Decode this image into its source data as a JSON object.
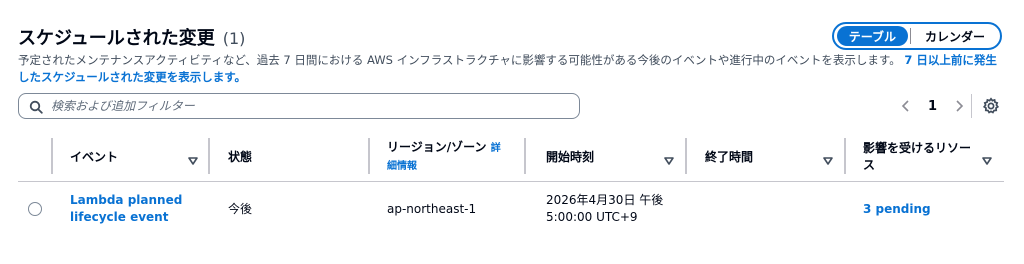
{
  "header": {
    "title": "スケジュールされた変更",
    "count": "(1)",
    "view_toggle": {
      "table_label": "テーブル",
      "calendar_label": "カレンダー",
      "selected": "テーブル"
    },
    "description": "予定されたメンテナンスアクティビティなど、過去 7 日間における AWS インフラストラクチャに影響する可能性がある今後のイベントや進行中のイベントを表示します。",
    "description_link": "7 日以上前に発生したスケジュールされた変更を表示します。"
  },
  "filter": {
    "placeholder": "検索および追加フィルター",
    "icon": "search-icon"
  },
  "pagination": {
    "current_page": "1",
    "prev_icon": "chevron-left-icon",
    "next_icon": "chevron-right-icon",
    "settings_icon": "gear-icon"
  },
  "table": {
    "columns": {
      "event": "イベント",
      "status": "状態",
      "region": "リージョン/ゾーン",
      "region_info": "詳細情報",
      "start": "開始時刻",
      "end": "終了時間",
      "resources": "影響を受けるリソース"
    },
    "rows": [
      {
        "event_line1": "Lambda planned",
        "event_line2": "lifecycle event",
        "status": "今後",
        "region": "ap-northeast-1",
        "start_line1": "2026年4月30日 午後",
        "start_line2": "5:00:00 UTC+9",
        "end": "",
        "resources": "3 pending"
      }
    ]
  },
  "colors": {
    "accent": "#0972d3",
    "text": "#000716",
    "muted": "#414d5c",
    "border": "#c6c6cd"
  }
}
